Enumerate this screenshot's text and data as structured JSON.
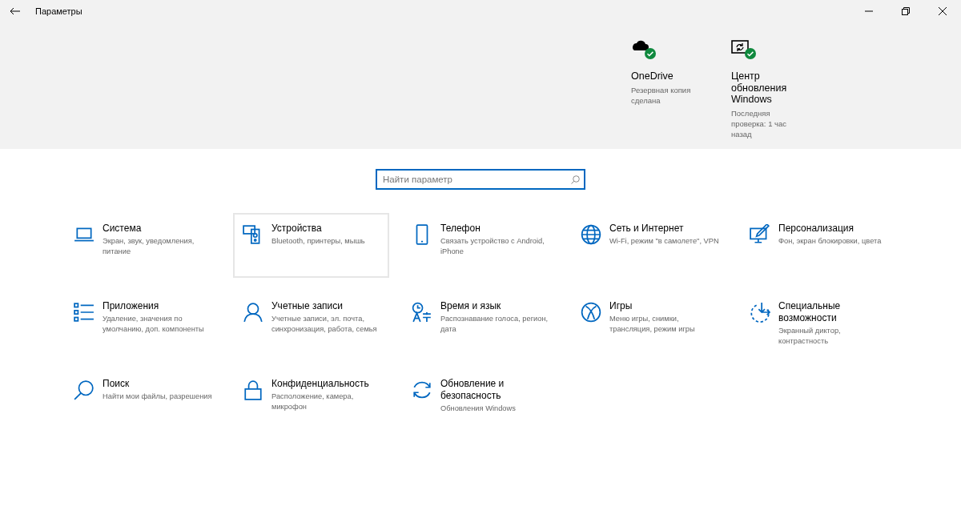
{
  "window": {
    "title": "Параметры"
  },
  "status": [
    {
      "kind": "cloud",
      "title": "OneDrive",
      "subtitle": "Резервная копия сделана",
      "ok": true
    },
    {
      "kind": "update",
      "title": "Центр обновления Windows",
      "subtitle": "Последняя проверка: 1 час назад",
      "ok": true
    }
  ],
  "search": {
    "placeholder": "Найти параметр"
  },
  "categories": [
    {
      "kind": "laptop",
      "title": "Система",
      "subtitle": "Экран, звук, уведомления, питание",
      "selected": false
    },
    {
      "kind": "devices",
      "title": "Устройства",
      "subtitle": "Bluetooth, принтеры, мышь",
      "selected": true
    },
    {
      "kind": "phone",
      "title": "Телефон",
      "subtitle": "Связать устройство с Android, iPhone",
      "selected": false
    },
    {
      "kind": "globe",
      "title": "Сеть и Интернет",
      "subtitle": "Wi-Fi, режим \"в самолете\", VPN",
      "selected": false
    },
    {
      "kind": "paint",
      "title": "Персонализация",
      "subtitle": "Фон, экран блокировки, цвета",
      "selected": false
    },
    {
      "kind": "apps",
      "title": "Приложения",
      "subtitle": "Удаление, значения по умолчанию, доп. компоненты",
      "selected": false
    },
    {
      "kind": "person",
      "title": "Учетные записи",
      "subtitle": "Учетные записи, эл. почта, синхронизация, работа, семья",
      "selected": false
    },
    {
      "kind": "language",
      "title": "Время и язык",
      "subtitle": "Распознавание голоса, регион, дата",
      "selected": false
    },
    {
      "kind": "xbox",
      "title": "Игры",
      "subtitle": "Меню игры, снимки, трансляция, режим игры",
      "selected": false
    },
    {
      "kind": "access",
      "title": "Специальные возможности",
      "subtitle": "Экранный диктор, контрастность",
      "selected": false
    },
    {
      "kind": "search",
      "title": "Поиск",
      "subtitle": "Найти мои файлы, разрешения",
      "selected": false
    },
    {
      "kind": "lock",
      "title": "Конфиденциальность",
      "subtitle": "Расположение, камера, микрофон",
      "selected": false
    },
    {
      "kind": "sync",
      "title": "Обновление и безопасность",
      "subtitle": "Обновления Windows",
      "selected": false
    }
  ]
}
